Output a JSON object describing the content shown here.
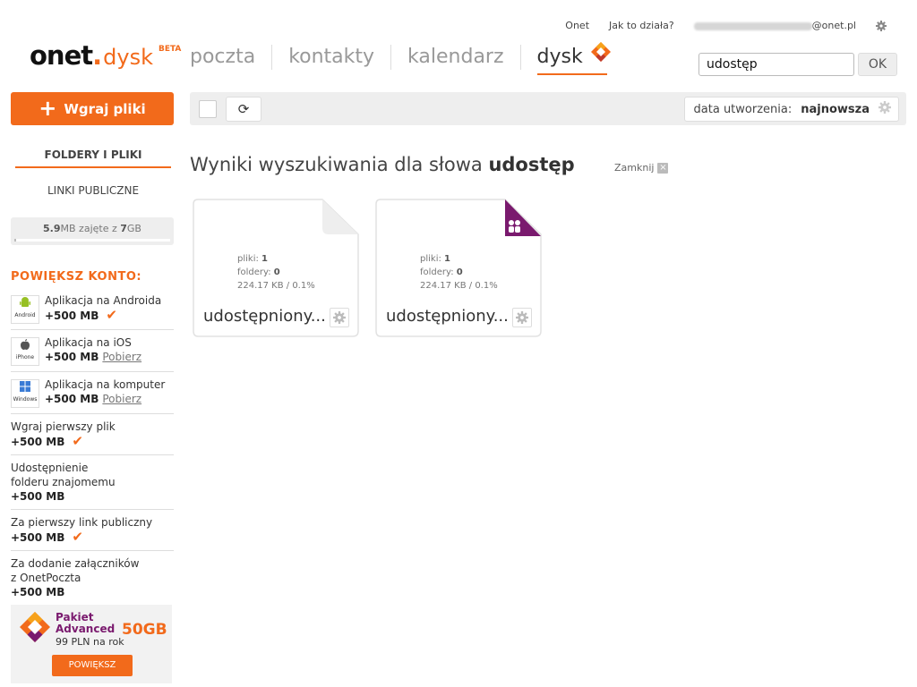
{
  "header": {
    "links": [
      "Onet",
      "Jak to działa?"
    ],
    "email_suffix": "@onet.pl",
    "logo": {
      "brand": "onet",
      "product": "dysk",
      "badge": "BETA"
    },
    "nav": [
      {
        "label": "poczta",
        "active": false
      },
      {
        "label": "kontakty",
        "active": false
      },
      {
        "label": "kalendarz",
        "active": false
      },
      {
        "label": "dysk",
        "active": true
      }
    ],
    "search": {
      "value": "udostęp",
      "button": "OK"
    }
  },
  "sidebar": {
    "upload_label": "Wgraj pliki",
    "tabs": [
      {
        "label": "FOLDERY I PLIKI",
        "active": true
      },
      {
        "label": "LINKI PUBLICZNE",
        "active": false
      }
    ],
    "quota": {
      "used": "5.9",
      "used_unit": "MB zajęte z ",
      "total": "7",
      "total_unit": "GB",
      "used_fraction": 0.0008
    },
    "promo_title": "POWIĘKSZ KONTO:",
    "promos": [
      {
        "icon": "android-icon",
        "icon_label": "Android",
        "text": "Aplikacja na Androida",
        "bonus": "+500 MB",
        "done": true,
        "link": ""
      },
      {
        "icon": "apple-icon",
        "icon_label": "iPhone",
        "text": "Aplikacja na iOS",
        "bonus": "+500 MB",
        "done": false,
        "link": "Pobierz"
      },
      {
        "icon": "windows-icon",
        "icon_label": "Windows",
        "text": "Aplikacja na komputer",
        "bonus": "+500 MB",
        "done": false,
        "link": "Pobierz"
      },
      {
        "icon": "",
        "text": "Wgraj pierwszy plik",
        "bonus": "+500 MB",
        "done": true,
        "link": ""
      },
      {
        "icon": "",
        "text": "Udostępnienie folderu znajomemu",
        "bonus": "+500 MB",
        "done": false,
        "link": ""
      },
      {
        "icon": "",
        "text": "Za pierwszy link publiczny",
        "bonus": "+500 MB",
        "done": true,
        "link": ""
      },
      {
        "icon": "",
        "text": "Za dodanie załączników z OnetPoczta",
        "bonus": "+500 MB",
        "done": false,
        "link": ""
      }
    ],
    "advanced": {
      "name_line1": "Pakiet",
      "name_line2": "Advanced",
      "size": "50GB",
      "price": "99 PLN na rok",
      "button": "POWIĘKSZ"
    }
  },
  "toolbar": {
    "sort_label": "data utworzenia:",
    "sort_value": "najnowsza"
  },
  "results": {
    "heading_prefix": "Wyniki wyszukiwania dla słowa ",
    "query": "udostęp",
    "close_label": "Zamknij"
  },
  "folders": [
    {
      "name": "udostępniony...",
      "files_label": "pliki:",
      "files": "1",
      "folders_label": "foldery:",
      "folders": "0",
      "size": "224.17 KB / 0.1%",
      "shared": false
    },
    {
      "name": "udostępniony...",
      "files_label": "pliki:",
      "files": "1",
      "folders_label": "foldery:",
      "folders": "0",
      "size": "224.17 KB / 0.1%",
      "shared": true
    }
  ],
  "colors": {
    "accent": "#f26a1b",
    "shared_badge": "#7a1a6e"
  }
}
